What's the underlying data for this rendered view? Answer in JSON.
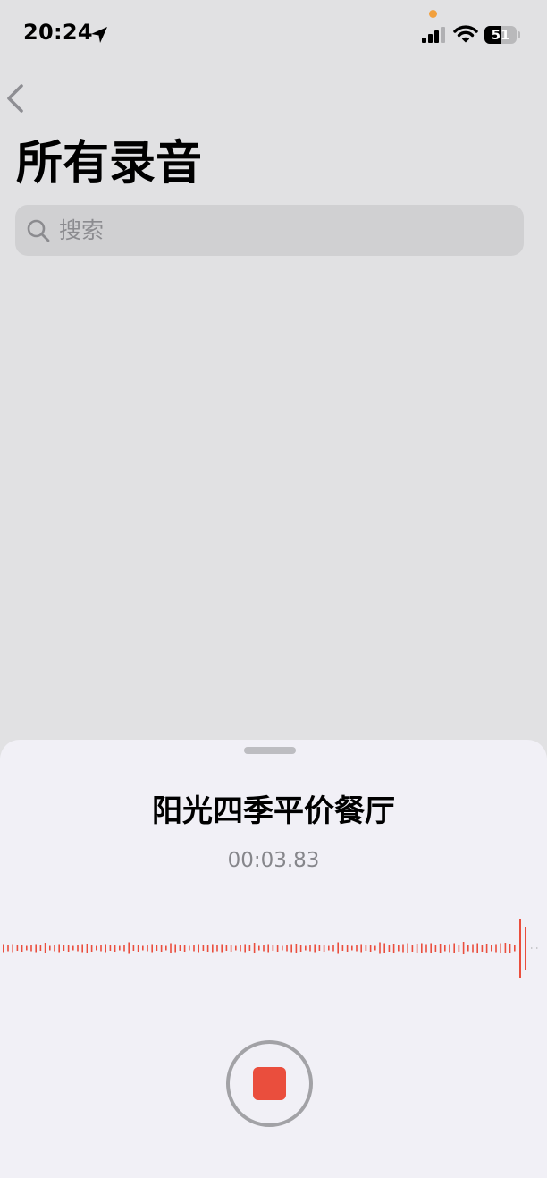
{
  "status_bar": {
    "time": "20:24",
    "battery_percent": 51,
    "location_icon": "location-arrow-icon",
    "signal_icon": "cellular-signal-icon",
    "wifi_icon": "wifi-icon",
    "privacy_dot_color": "#f2a03d"
  },
  "nav": {
    "back_icon": "chevron-left-icon",
    "title": "所有录音"
  },
  "search": {
    "placeholder": "搜索",
    "icon": "search-icon"
  },
  "recording": {
    "title": "阳光四季平价餐厅",
    "elapsed": "00:03.83",
    "waveform_color": "#ea4e3d",
    "stop_button_color": "#ea4e3d",
    "stop_icon": "stop-icon"
  }
}
